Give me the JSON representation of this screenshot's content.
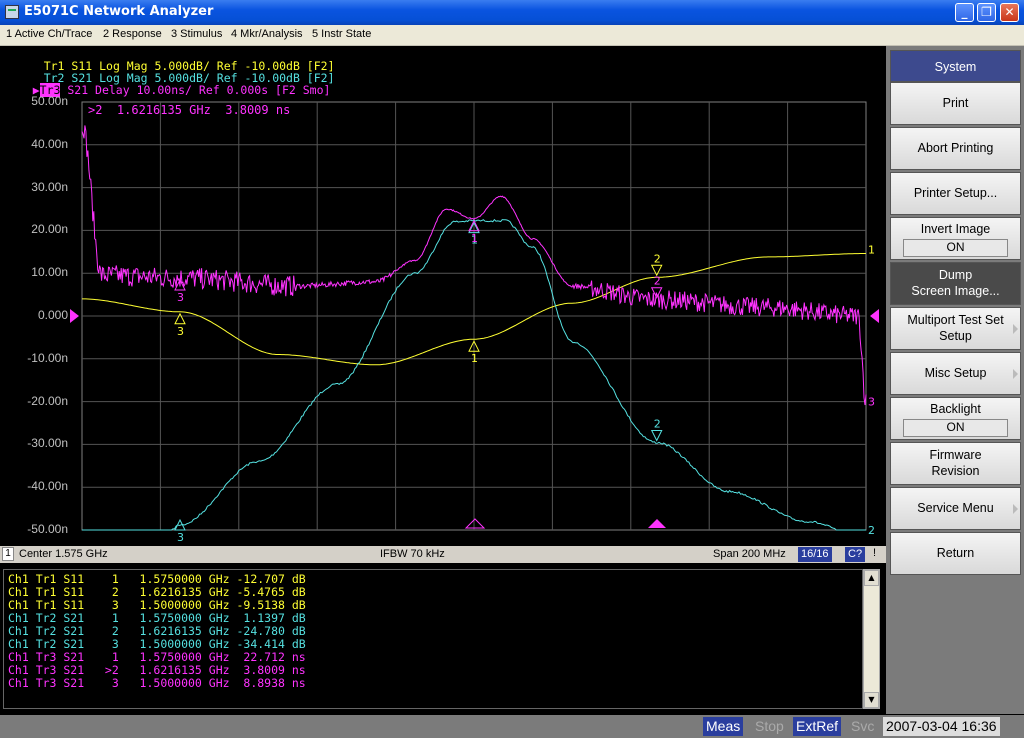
{
  "window": {
    "title": "E5071C Network Analyzer",
    "minimize": "_",
    "restore": "❐",
    "close": "✕"
  },
  "menu": [
    "1 Active Ch/Trace",
    "2 Response",
    "3 Stimulus",
    "4 Mkr/Analysis",
    "5 Instr State"
  ],
  "traces": {
    "tr1": {
      "label": "Tr1",
      "text": " S11 Log Mag 5.000dB/ Ref -10.00dB [F2]",
      "color": "#ffff33"
    },
    "tr2": {
      "label": "Tr2",
      "text": " S21 Log Mag 5.000dB/ Ref -10.00dB [F2]",
      "color": "#55e0e0"
    },
    "tr3": {
      "label": "Tr3",
      "text": " S21 Delay 10.00ns/ Ref 0.000s [F2 Smo]",
      "color": "#ff33ff"
    }
  },
  "active_marker_readout": ">2  1.6216135 GHz  3.8009 ns",
  "y_axis_labels": [
    "50.00n",
    "40.00n",
    "30.00n",
    "20.00n",
    "10.00n",
    "0.000",
    "-10.00n",
    "-20.00n",
    "-30.00n",
    "-40.00n",
    "-50.00n"
  ],
  "chart_data": {
    "type": "line",
    "x_unit": "GHz",
    "xlim": [
      1.475,
      1.675
    ],
    "center": "1.575 GHz",
    "span": "200 MHz",
    "ylim_delay_ns": [
      -50,
      50
    ],
    "grid": true,
    "series": [
      {
        "name": "S11 Log Mag",
        "color": "#ffff33",
        "x": [
          1.475,
          1.5,
          1.525,
          1.55,
          1.575,
          1.6,
          1.6216,
          1.65,
          1.675
        ],
        "db": [
          -8.0,
          -9.51,
          -14.5,
          -15.7,
          -12.71,
          -8.5,
          -5.48,
          -3.1,
          -2.7
        ]
      },
      {
        "name": "S21 Log Mag",
        "color": "#55e0e0",
        "x": [
          1.475,
          1.48,
          1.5,
          1.52,
          1.54,
          1.56,
          1.57,
          1.575,
          1.583,
          1.59,
          1.6,
          1.6216,
          1.64,
          1.66,
          1.675
        ],
        "db": [
          -60,
          -60,
          -34.41,
          -27.0,
          -18.0,
          -5.0,
          1.0,
          1.14,
          1.14,
          -2.0,
          -13.0,
          -24.78,
          -30.5,
          -34.0,
          -36.0
        ]
      },
      {
        "name": "S21 Delay",
        "color": "#ff33ff",
        "x": [
          1.475,
          1.48,
          1.5,
          1.53,
          1.55,
          1.56,
          1.568,
          1.575,
          1.582,
          1.59,
          1.6,
          1.6216,
          1.65,
          1.673,
          1.675
        ],
        "ns": [
          45,
          9.5,
          8.89,
          7.0,
          8.0,
          13.0,
          25.0,
          22.71,
          28.0,
          18.0,
          7.0,
          3.8,
          2.0,
          0.0,
          -20.0
        ]
      }
    ],
    "markers": [
      {
        "trace": "Tr1",
        "id": "1",
        "x": 1.575
      },
      {
        "trace": "Tr1",
        "id": "2",
        "x": 1.6216135
      },
      {
        "trace": "Tr1",
        "id": "3",
        "x": 1.5
      },
      {
        "trace": "Tr2",
        "id": "1",
        "x": 1.575
      },
      {
        "trace": "Tr2",
        "id": "2",
        "x": 1.6216135
      },
      {
        "trace": "Tr2",
        "id": "3",
        "x": 1.5
      },
      {
        "trace": "Tr3",
        "id": "1",
        "x": 1.575
      },
      {
        "trace": "Tr3",
        "id": "2",
        "x": 1.6216135
      },
      {
        "trace": "Tr3",
        "id": "3",
        "x": 1.5
      }
    ],
    "end_labels": {
      "tr1": "1",
      "tr2": "2",
      "tr3": "3"
    }
  },
  "status": {
    "channel": "1",
    "center": "Center 1.575 GHz",
    "ifbw": "IFBW 70 kHz",
    "span": "Span 200 MHz",
    "points": "16/16",
    "cal": "C?",
    "warn": "!"
  },
  "marker_table": [
    {
      "ch": "Ch1",
      "tr": "Tr1",
      "param": "S11",
      "mk": "1",
      "freq": "1.5750000 GHz",
      "value": "-12.707",
      "unit": "dB",
      "color": "#ffff33"
    },
    {
      "ch": "Ch1",
      "tr": "Tr1",
      "param": "S11",
      "mk": "2",
      "freq": "1.6216135 GHz",
      "value": "-5.4765",
      "unit": "dB",
      "color": "#ffff33"
    },
    {
      "ch": "Ch1",
      "tr": "Tr1",
      "param": "S11",
      "mk": "3",
      "freq": "1.5000000 GHz",
      "value": "-9.5138",
      "unit": "dB",
      "color": "#ffff33"
    },
    {
      "ch": "Ch1",
      "tr": "Tr2",
      "param": "S21",
      "mk": "1",
      "freq": "1.5750000 GHz",
      "value": "1.1397",
      "unit": "dB",
      "color": "#55e0e0"
    },
    {
      "ch": "Ch1",
      "tr": "Tr2",
      "param": "S21",
      "mk": "2",
      "freq": "1.6216135 GHz",
      "value": "-24.780",
      "unit": "dB",
      "color": "#55e0e0"
    },
    {
      "ch": "Ch1",
      "tr": "Tr2",
      "param": "S21",
      "mk": "3",
      "freq": "1.5000000 GHz",
      "value": "-34.414",
      "unit": "dB",
      "color": "#55e0e0"
    },
    {
      "ch": "Ch1",
      "tr": "Tr3",
      "param": "S21",
      "mk": "1",
      "freq": "1.5750000 GHz",
      "value": "22.712",
      "unit": "ns",
      "color": "#ff33ff"
    },
    {
      "ch": "Ch1",
      "tr": "Tr3",
      "param": "S21",
      "mk": ">2",
      "freq": "1.6216135 GHz",
      "value": "3.8009",
      "unit": "ns",
      "color": "#ff33ff"
    },
    {
      "ch": "Ch1",
      "tr": "Tr3",
      "param": "S21",
      "mk": "3",
      "freq": "1.5000000 GHz",
      "value": "8.8938",
      "unit": "ns",
      "color": "#ff33ff"
    }
  ],
  "softkeys": {
    "title": "System",
    "items": [
      {
        "line1": "Print"
      },
      {
        "line1": "Abort Printing"
      },
      {
        "line1": "Printer Setup..."
      },
      {
        "line1": "Invert Image",
        "value": "ON"
      },
      {
        "line1": "Dump",
        "line2": "Screen Image..."
      },
      {
        "line1": "Multiport Test Set",
        "line2": "Setup"
      },
      {
        "line1": "Misc Setup"
      },
      {
        "line1": "Backlight",
        "value": "ON"
      },
      {
        "line1": "Firmware",
        "line2": "Revision"
      },
      {
        "line1": "Service Menu"
      },
      {
        "line1": "Return"
      }
    ]
  },
  "footer": {
    "meas": "Meas",
    "stop": "Stop",
    "extref": "ExtRef",
    "svc": "Svc",
    "datetime": "2007-03-04 16:36"
  }
}
